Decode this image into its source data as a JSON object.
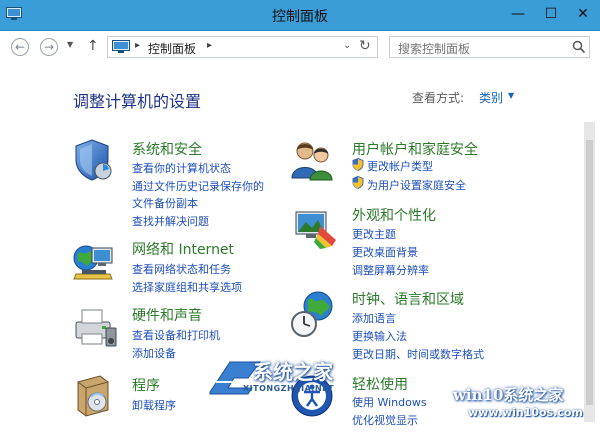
{
  "window": {
    "title": "控制面板"
  },
  "window_controls": {
    "minimize": "—",
    "maximize": "☐",
    "close": "✕"
  },
  "nav": {
    "back": "←",
    "forward": "→",
    "recent": "▼",
    "up": "↑",
    "breadcrumb_sep": "▸",
    "breadcrumb": "控制面板",
    "dropdown": "⌄",
    "refresh": "↻",
    "search_placeholder": "搜索控制面板"
  },
  "content": {
    "heading": "调整计算机的设置",
    "view_by_label": "查看方式:",
    "view_by_value": "类别",
    "view_by_caret": "▼"
  },
  "categories": [
    {
      "icon": "security-shield-icon",
      "title": "系统和安全",
      "links": [
        "查看你的计算机状态",
        "通过文件历史记录保存你的",
        "文件备份副本",
        "查找并解决问题"
      ]
    },
    {
      "icon": "network-globe-icon",
      "title": "网络和 Internet",
      "links": [
        "查看网络状态和任务",
        "选择家庭组和共享选项"
      ]
    },
    {
      "icon": "printer-speaker-icon",
      "title": "硬件和声音",
      "links": [
        "查看设备和打印机",
        "添加设备"
      ]
    },
    {
      "icon": "programs-box-icon",
      "title": "程序",
      "links": [
        "卸载程序"
      ]
    },
    {
      "icon": "users-icon",
      "title": "用户帐户和家庭安全",
      "links": [
        "更改帐户类型",
        "为用户设置家庭安全"
      ]
    },
    {
      "icon": "appearance-monitor-icon",
      "title": "外观和个性化",
      "links": [
        "更改主题",
        "更改桌面背景",
        "调整屏幕分辨率"
      ]
    },
    {
      "icon": "clock-globe-icon",
      "title": "时钟、语言和区域",
      "links": [
        "添加语言",
        "更换输入法",
        "更改日期、时间或数字格式"
      ]
    },
    {
      "icon": "ease-of-access-icon",
      "title": "轻松使用",
      "links": [
        "使用 Windows",
        "优化视觉显示"
      ]
    }
  ],
  "watermarks": {
    "logo_text": "系统之家",
    "logo_url": "XITONGZHIJIA.NET",
    "site_text": "win10系统之家",
    "site_url": "www.win10os.com"
  },
  "colors": {
    "titlebar": "#3b9dd8",
    "heading": "#1e3287",
    "category_title": "#2b7a2b",
    "link": "#1f4fb8"
  }
}
